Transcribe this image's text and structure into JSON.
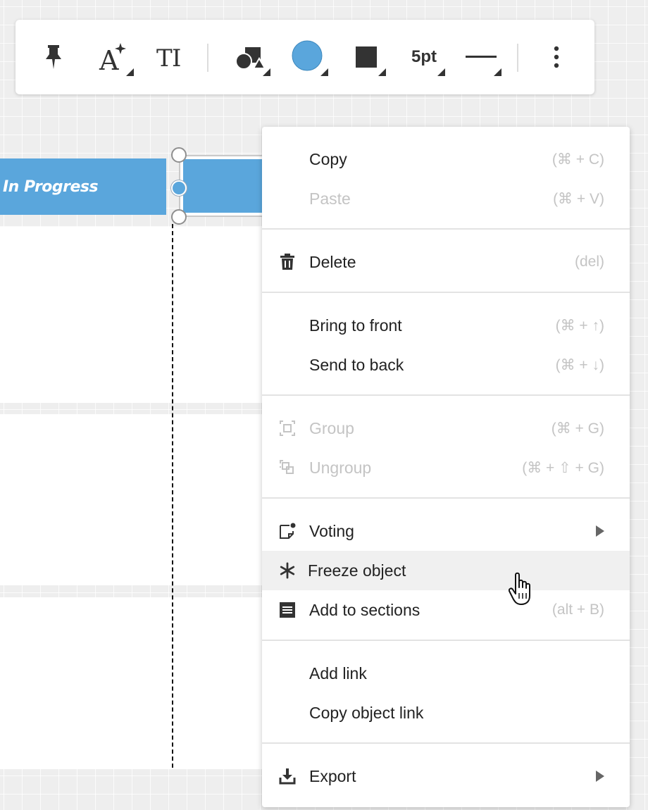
{
  "toolbar": {
    "buttons": [
      {
        "name": "pin-icon"
      },
      {
        "name": "text-style-icon"
      },
      {
        "name": "text-size-icon"
      },
      {
        "name": "shape-icon"
      },
      {
        "name": "fill-color-icon",
        "color": "#5aa6dc"
      },
      {
        "name": "border-color-icon",
        "color": "#333333"
      },
      {
        "name": "border-width",
        "label": "5pt"
      },
      {
        "name": "line-style-icon"
      },
      {
        "name": "more-icon"
      }
    ]
  },
  "board": {
    "header_label": "In Progress",
    "accent_color": "#5aa6dc"
  },
  "context_menu": {
    "items": [
      {
        "label": "Copy",
        "shortcut": "(⌘ + C)",
        "icon": "",
        "enabled": true
      },
      {
        "label": "Paste",
        "shortcut": "(⌘ + V)",
        "icon": "",
        "enabled": false
      },
      {
        "label": "Delete",
        "shortcut": "(del)",
        "icon": "trash-icon",
        "enabled": true
      },
      {
        "label": "Bring to front",
        "shortcut": "(⌘ + ↑)",
        "icon": "",
        "enabled": true
      },
      {
        "label": "Send to back",
        "shortcut": "(⌘ + ↓)",
        "icon": "",
        "enabled": true
      },
      {
        "label": "Group",
        "shortcut": "(⌘ + G)",
        "icon": "group-icon",
        "enabled": false
      },
      {
        "label": "Ungroup",
        "shortcut": "(⌘ + ⇧ + G)",
        "icon": "ungroup-icon",
        "enabled": false
      },
      {
        "label": "Voting",
        "shortcut": "",
        "icon": "voting-icon",
        "enabled": true,
        "submenu": true
      },
      {
        "label": "Freeze object",
        "shortcut": "",
        "icon": "snowflake-icon",
        "enabled": true,
        "hovered": true
      },
      {
        "label": "Add to sections",
        "shortcut": "(alt + B)",
        "icon": "sections-icon",
        "enabled": true
      },
      {
        "label": "Add link",
        "shortcut": "",
        "icon": "",
        "enabled": true
      },
      {
        "label": "Copy object link",
        "shortcut": "",
        "icon": "",
        "enabled": true
      },
      {
        "label": "Export",
        "shortcut": "",
        "icon": "export-icon",
        "enabled": true,
        "submenu": true
      }
    ]
  }
}
